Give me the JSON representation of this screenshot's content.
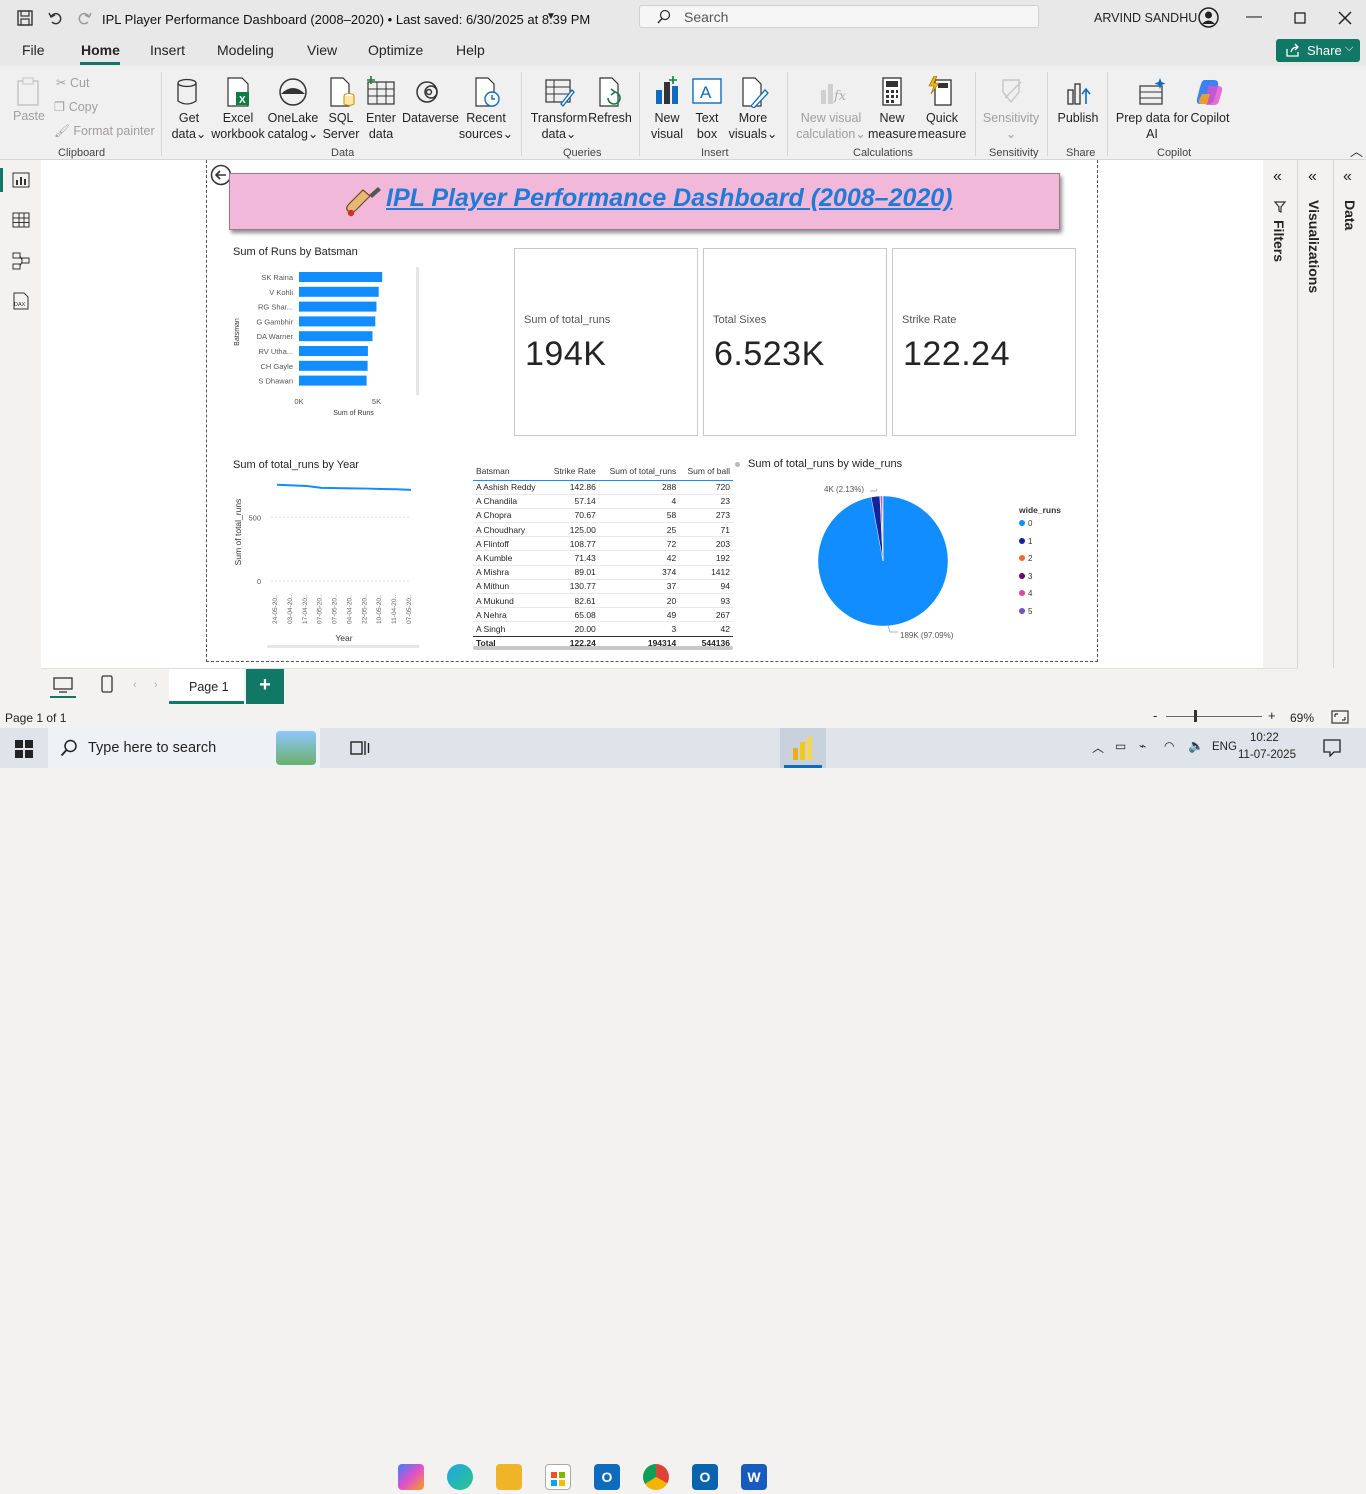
{
  "window": {
    "title": "IPL Player Performance Dashboard (2008–2020) • Last saved: 6/30/2025 at 8:39 PM",
    "search_placeholder": "Search",
    "user": "ARVIND SANDHU"
  },
  "menu": [
    "File",
    "Home",
    "Insert",
    "Modeling",
    "View",
    "Optimize",
    "Help"
  ],
  "share_label": "Share",
  "ribbon": {
    "clipboard": {
      "paste": "Paste",
      "cut": "Cut",
      "copy": "Copy",
      "format_painter": "Format painter",
      "group": "Clipboard"
    },
    "data": {
      "get_data": [
        "Get",
        "data"
      ],
      "excel": [
        "Excel",
        "workbook"
      ],
      "onelake": [
        "OneLake",
        "catalog"
      ],
      "sql": [
        "SQL",
        "Server"
      ],
      "enter": [
        "Enter",
        "data"
      ],
      "dataverse": "Dataverse",
      "recent": [
        "Recent",
        "sources"
      ],
      "group": "Data"
    },
    "queries": {
      "transform": [
        "Transform",
        "data"
      ],
      "refresh": "Refresh",
      "group": "Queries"
    },
    "insert": {
      "new_visual": [
        "New",
        "visual"
      ],
      "text_box": [
        "Text",
        "box"
      ],
      "more_visuals": [
        "More",
        "visuals"
      ],
      "group": "Insert"
    },
    "calculations": {
      "new_visual_calc": [
        "New visual",
        "calculation"
      ],
      "new_measure": [
        "New",
        "measure"
      ],
      "quick_measure": [
        "Quick",
        "measure"
      ],
      "group": "Calculations"
    },
    "sensitivity": {
      "label": "Sensitivity",
      "group": "Sensitivity"
    },
    "share": {
      "publish": "Publish",
      "group": "Share"
    },
    "copilot": {
      "prep": [
        "Prep data for",
        "AI"
      ],
      "copilot": "Copilot",
      "group": "Copilot"
    }
  },
  "report_title": "IPL Player Performance Dashboard (2008–2020)",
  "bar_chart": {
    "title": "Sum of Runs by Batsman",
    "ylabel": "Batsman",
    "xlabel": "Sum of Runs",
    "ticks": [
      "0K",
      "5K"
    ]
  },
  "cards": [
    {
      "label": "Sum of total_runs",
      "value": "194K"
    },
    {
      "label": "Total Sixes",
      "value": "6.523K"
    },
    {
      "label": "Strike Rate",
      "value": "122.24"
    }
  ],
  "line_chart": {
    "title": "Sum of total_runs by Year",
    "ylabel": "Sum of total_runs",
    "xlabel": "Year",
    "yticks": [
      "500",
      "0"
    ],
    "xticks": [
      "24-05-20..",
      "03-04-20..",
      "17-04-20..",
      "07-05-20..",
      "07-05-20..",
      "04-04-20..",
      "22-05-20..",
      "10-05-20..",
      "11-04-20..",
      "07-05-20.."
    ]
  },
  "table": {
    "headers": [
      "Batsman",
      "Strike Rate",
      "Sum of total_runs",
      "Sum of ball"
    ],
    "rows": [
      [
        "A Ashish Reddy",
        "142.86",
        "288",
        "720"
      ],
      [
        "A Chandila",
        "57.14",
        "4",
        "23"
      ],
      [
        "A Chopra",
        "70.67",
        "58",
        "273"
      ],
      [
        "A Choudhary",
        "125.00",
        "25",
        "71"
      ],
      [
        "A Flintoff",
        "108.77",
        "72",
        "203"
      ],
      [
        "A Kumble",
        "71.43",
        "42",
        "192"
      ],
      [
        "A Mishra",
        "89.01",
        "374",
        "1412"
      ],
      [
        "A Mithun",
        "130.77",
        "37",
        "94"
      ],
      [
        "A Mukund",
        "82.61",
        "20",
        "93"
      ],
      [
        "A Nehra",
        "65.08",
        "49",
        "267"
      ],
      [
        "A Singh",
        "20.00",
        "3",
        "42"
      ]
    ],
    "total": [
      "Total",
      "122.24",
      "194314",
      "544136"
    ]
  },
  "pie_chart": {
    "title": "Sum of total_runs by wide_runs",
    "label_small": "4K (2.13%)",
    "label_big": "189K (97.09%)",
    "legend_title": "wide_runs",
    "legend": [
      "0",
      "1",
      "2",
      "3",
      "4",
      "5"
    ]
  },
  "chart_data": [
    {
      "type": "bar",
      "title": "Sum of Runs by Batsman",
      "categories": [
        "SK Raina",
        "V Kohli",
        "RG Shar...",
        "G Gambhir",
        "DA Warner",
        "RV Utha...",
        "CH Gayle",
        "S Dhawan"
      ],
      "values": [
        5368,
        5142,
        4998,
        4922,
        4741,
        4447,
        4426,
        4362
      ],
      "xlim": [
        0,
        6000
      ],
      "xlabel": "Sum of Runs",
      "ylabel": "Batsman",
      "color": "#118dff"
    },
    {
      "type": "line",
      "title": "Sum of total_runs by Year",
      "x": [
        "24-05-20..",
        "03-04-20..",
        "17-04-20..",
        "07-05-20..",
        "07-05-20..",
        "04-04-20..",
        "22-05-20..",
        "10-05-20..",
        "11-04-20..",
        "07-05-20.."
      ],
      "values": [
        755,
        750,
        745,
        730,
        728,
        726,
        725,
        722,
        720,
        715
      ],
      "ylim": [
        0,
        800
      ],
      "ylabel": "Sum of total_runs",
      "xlabel": "Year",
      "color": "#118dff"
    },
    {
      "type": "pie",
      "title": "Sum of total_runs by wide_runs",
      "labels": [
        "0",
        "1",
        "2",
        "3",
        "4",
        "5"
      ],
      "values": [
        97.09,
        2.13,
        0.2,
        0.3,
        0.15,
        0.13
      ],
      "colors": [
        "#118dff",
        "#12239e",
        "#e66c37",
        "#6b007b",
        "#e044a7",
        "#744ec2"
      ]
    }
  ],
  "pages": {
    "tab": "Page 1",
    "status": "Page 1 of 1",
    "zoom": "69%"
  },
  "taskbar": {
    "search": "Type here to search",
    "lang": "ENG",
    "time": "10:22",
    "date": "11-07-2025"
  }
}
